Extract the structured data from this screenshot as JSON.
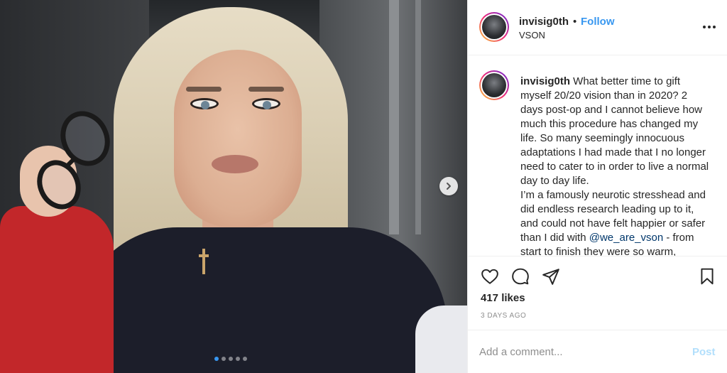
{
  "post": {
    "username": "invisig0th",
    "separator": "•",
    "follow_label": "Follow",
    "location": "VSON",
    "caption_username": "invisig0th",
    "caption_part1": " What better time to gift myself 20/20 vision than in 2020? 2 days post-op and I cannot believe how much this procedure has changed my life. So many seemingly innocuous adaptations I had made that I no longer need to cater to in order to live a normal day to day life.",
    "caption_part2": "I’m a famously neurotic stresshead and did endless research leading up to it, and could not have felt happier or safer than I did with ",
    "caption_mention": "@we_are_vson",
    "caption_part3": " - from start to finish they were so warm,",
    "likes": "417 likes",
    "date": "3 DAYS AGO",
    "comment_placeholder": "Add a comment...",
    "post_label": "Post"
  },
  "carousel": {
    "total": 5,
    "active_index": 0
  },
  "icons": {
    "like": "heart-icon",
    "comment": "comment-bubble-icon",
    "share": "paper-plane-icon",
    "save": "bookmark-icon",
    "more": "more-options-icon",
    "next": "chevron-right-icon"
  },
  "colors": {
    "accent": "#3897f0",
    "mention": "#00376b",
    "post_disabled": "#b2dffc",
    "muted": "#8e8e8e"
  }
}
